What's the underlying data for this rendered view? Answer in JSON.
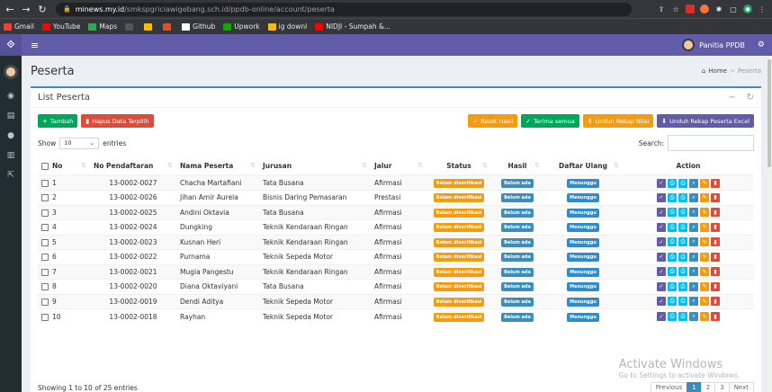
{
  "browser": {
    "url_host": "minews.my.id",
    "url_path": "/smkspgriciawigebang.sch.id/ppdb-online/account/peserta",
    "bookmarks": [
      {
        "label": "Gmail",
        "color": "#ea4335"
      },
      {
        "label": "YouTube",
        "color": "#ff0000"
      },
      {
        "label": "Maps",
        "color": "#34a853"
      },
      {
        "label": "",
        "color": "#555555"
      },
      {
        "label": "",
        "color": "#fbbc04"
      },
      {
        "label": "",
        "color": "#e34f26"
      },
      {
        "label": "Github",
        "color": "#ffffff"
      },
      {
        "label": "Upwork",
        "color": "#14a800"
      },
      {
        "label": "ig downl",
        "color": "#fbbc04"
      },
      {
        "label": "NIDJI - Sumpah &...",
        "color": "#ff0000"
      }
    ]
  },
  "header": {
    "user_name": "Panitia PPDB"
  },
  "page": {
    "title": "Peserta",
    "breadcrumb_home": "Home",
    "breadcrumb_current": "Peserta"
  },
  "box": {
    "title": "List Peserta"
  },
  "toolbar": {
    "tambah": "Tambah",
    "hapus": "Hapus Data Terpilih",
    "reset": "Reset Hasil",
    "terima": "Terima semua",
    "unduh_nilai": "Unduh Rekap Nilai",
    "unduh_excel": "Unduh Rekap Peserta Excel"
  },
  "listing": {
    "show_label": "Show",
    "show_value": "10",
    "entries_label": "entries",
    "search_label": "Search:"
  },
  "table": {
    "headers": [
      "No",
      "No Pendaftaran",
      "Nama Peserta",
      "Jurusan",
      "Jalur",
      "Status",
      "Hasil",
      "Daftar Ulang",
      "Action"
    ],
    "rows": [
      [
        "1",
        "13-0002-0027",
        "Chacha Martafiani",
        "Tata Busana",
        "Afirmasi",
        "Belum diverifikasi",
        "Belum ada",
        "Menunggu"
      ],
      [
        "2",
        "13-0002-0026",
        "Jihan Amir Aurela",
        "Bisnis Daring Pemasaran",
        "Prestasi",
        "Belum diverifikasi",
        "Belum ada",
        "Menunggu"
      ],
      [
        "3",
        "13-0002-0025",
        "Andini Oktavia",
        "Tata Busana",
        "Afirmasi",
        "Belum diverifikasi",
        "Belum ada",
        "Menunggu"
      ],
      [
        "4",
        "13-0002-0024",
        "Dungking",
        "Teknik Kendaraan Ringan",
        "Afirmasi",
        "Belum diverifikasi",
        "Belum ada",
        "Menunggu"
      ],
      [
        "5",
        "13-0002-0023",
        "Kusnan Heri",
        "Teknik Kendaraan Ringan",
        "Afirmasi",
        "Belum diverifikasi",
        "Belum ada",
        "Menunggu"
      ],
      [
        "6",
        "13-0002-0022",
        "Purnama",
        "Teknik Sepeda Motor",
        "Afirmasi",
        "Belum diverifikasi",
        "Belum ada",
        "Menunggu"
      ],
      [
        "7",
        "13-0002-0021",
        "Mugia Pangestu",
        "Teknik Kendaraan Ringan",
        "Afirmasi",
        "Belum diverifikasi",
        "Belum ada",
        "Menunggu"
      ],
      [
        "8",
        "13-0002-0020",
        "Diana Oktaviyani",
        "Tata Busana",
        "Afirmasi",
        "Belum diverifikasi",
        "Belum ada",
        "Menunggu"
      ],
      [
        "9",
        "13-0002-0019",
        "Dendi Aditya",
        "Teknik Sepeda Motor",
        "Afirmasi",
        "Belum diverifikasi",
        "Belum ada",
        "Menunggu"
      ],
      [
        "10",
        "13-0002-0018",
        "Rayhan",
        "Teknik Sepeda Motor",
        "Afirmasi",
        "Belum diverifikasi",
        "Belum ada",
        "Menunggu"
      ]
    ]
  },
  "footer": {
    "info": "Showing 1 to 10 of 25 entries",
    "previous": "Previous",
    "pages": [
      "1",
      "2",
      "3"
    ],
    "next": "Next"
  },
  "watermark": {
    "line1": "Activate Windows",
    "line2": "Go to Settings to activate Windows."
  },
  "colors": {
    "brand": "#605ca8",
    "sidebar": "#222d32",
    "primary": "#3c8dbc",
    "success": "#00a65a",
    "danger": "#dd4b39",
    "warning": "#f39c12"
  }
}
